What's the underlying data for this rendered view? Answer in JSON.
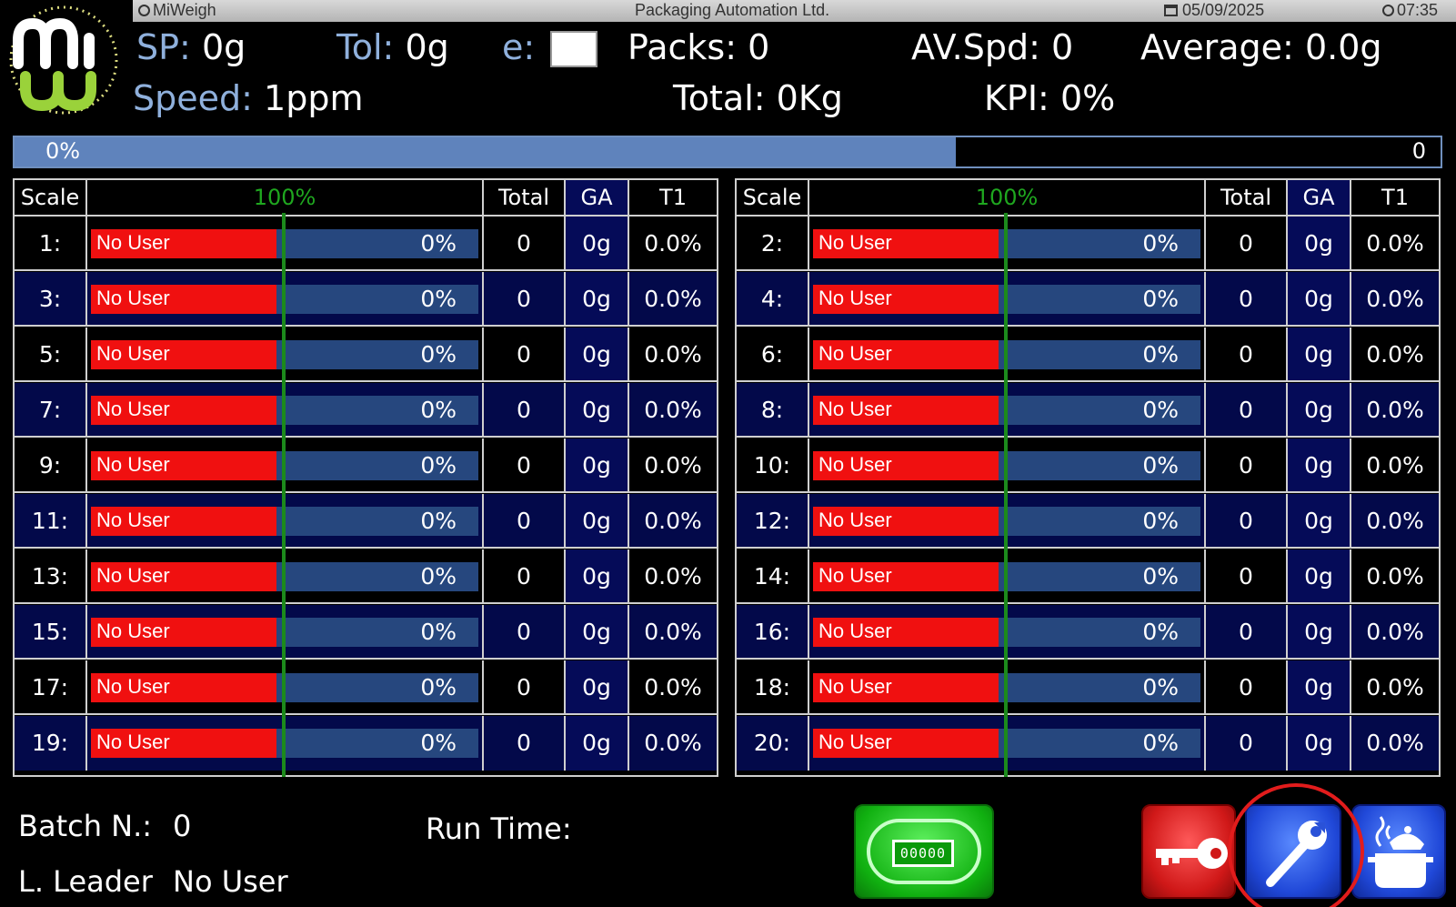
{
  "titlebar": {
    "app": "MiWeigh",
    "company": "Packaging Automation Ltd.",
    "date": "05/09/2025",
    "time": "07:35"
  },
  "header": {
    "sp_label": "SP:",
    "sp_value": "0g",
    "tol_label": "Tol:",
    "tol_value": "0g",
    "e_label": "e:",
    "packs_label": "Packs:",
    "packs_value": "0",
    "avspd_label": "AV.Spd:",
    "avspd_value": "0",
    "average_label": "Average:",
    "average_value": "0.0g",
    "speed_label": "Speed:",
    "speed_value": "1ppm",
    "total_label": "Total:",
    "total_value": "0Kg",
    "kpi_label": "KPI:",
    "kpi_value": "0%"
  },
  "progress": {
    "left_text": "0%",
    "right_text": "0",
    "fill_fraction": 0.66
  },
  "columns": {
    "scale": "Scale",
    "target": "100%",
    "total": "Total",
    "ga": "GA",
    "t1": "T1"
  },
  "left_rows": [
    {
      "scale": "1:",
      "user": "No User",
      "pct": "0%",
      "total": "0",
      "ga": "0g",
      "t1": "0.0%"
    },
    {
      "scale": "3:",
      "user": "No User",
      "pct": "0%",
      "total": "0",
      "ga": "0g",
      "t1": "0.0%"
    },
    {
      "scale": "5:",
      "user": "No User",
      "pct": "0%",
      "total": "0",
      "ga": "0g",
      "t1": "0.0%"
    },
    {
      "scale": "7:",
      "user": "No User",
      "pct": "0%",
      "total": "0",
      "ga": "0g",
      "t1": "0.0%"
    },
    {
      "scale": "9:",
      "user": "No User",
      "pct": "0%",
      "total": "0",
      "ga": "0g",
      "t1": "0.0%"
    },
    {
      "scale": "11:",
      "user": "No User",
      "pct": "0%",
      "total": "0",
      "ga": "0g",
      "t1": "0.0%"
    },
    {
      "scale": "13:",
      "user": "No User",
      "pct": "0%",
      "total": "0",
      "ga": "0g",
      "t1": "0.0%"
    },
    {
      "scale": "15:",
      "user": "No User",
      "pct": "0%",
      "total": "0",
      "ga": "0g",
      "t1": "0.0%"
    },
    {
      "scale": "17:",
      "user": "No User",
      "pct": "0%",
      "total": "0",
      "ga": "0g",
      "t1": "0.0%"
    },
    {
      "scale": "19:",
      "user": "No User",
      "pct": "0%",
      "total": "0",
      "ga": "0g",
      "t1": "0.0%"
    }
  ],
  "right_rows": [
    {
      "scale": "2:",
      "user": "No User",
      "pct": "0%",
      "total": "0",
      "ga": "0g",
      "t1": "0.0%"
    },
    {
      "scale": "4:",
      "user": "No User",
      "pct": "0%",
      "total": "0",
      "ga": "0g",
      "t1": "0.0%"
    },
    {
      "scale": "6:",
      "user": "No User",
      "pct": "0%",
      "total": "0",
      "ga": "0g",
      "t1": "0.0%"
    },
    {
      "scale": "8:",
      "user": "No User",
      "pct": "0%",
      "total": "0",
      "ga": "0g",
      "t1": "0.0%"
    },
    {
      "scale": "10:",
      "user": "No User",
      "pct": "0%",
      "total": "0",
      "ga": "0g",
      "t1": "0.0%"
    },
    {
      "scale": "12:",
      "user": "No User",
      "pct": "0%",
      "total": "0",
      "ga": "0g",
      "t1": "0.0%"
    },
    {
      "scale": "14:",
      "user": "No User",
      "pct": "0%",
      "total": "0",
      "ga": "0g",
      "t1": "0.0%"
    },
    {
      "scale": "16:",
      "user": "No User",
      "pct": "0%",
      "total": "0",
      "ga": "0g",
      "t1": "0.0%"
    },
    {
      "scale": "18:",
      "user": "No User",
      "pct": "0%",
      "total": "0",
      "ga": "0g",
      "t1": "0.0%"
    },
    {
      "scale": "20:",
      "user": "No User",
      "pct": "0%",
      "total": "0",
      "ga": "0g",
      "t1": "0.0%"
    }
  ],
  "footer": {
    "batch_label": "Batch N.:",
    "batch_value": "0",
    "leader_label": "L. Leader",
    "leader_value": "No User",
    "runtime_label": "Run Time:",
    "counter_text": "00000"
  },
  "buttons": [
    {
      "name": "counter-button",
      "icon": "counter-icon",
      "color": "#10b010"
    },
    {
      "name": "login-button",
      "icon": "key-icon",
      "color": "#d01818"
    },
    {
      "name": "settings-button",
      "icon": "wrench-icon",
      "color": "#2048d8"
    },
    {
      "name": "recipe-button",
      "icon": "cooking-pot-icon",
      "color": "#2048d8"
    }
  ],
  "colors": {
    "accent_blue": "#8fb0dc",
    "no_user_red": "#f01010",
    "row_navy": "#03094a",
    "target_green": "#1c8a1c",
    "highlight_ring": "#e21c1c"
  }
}
